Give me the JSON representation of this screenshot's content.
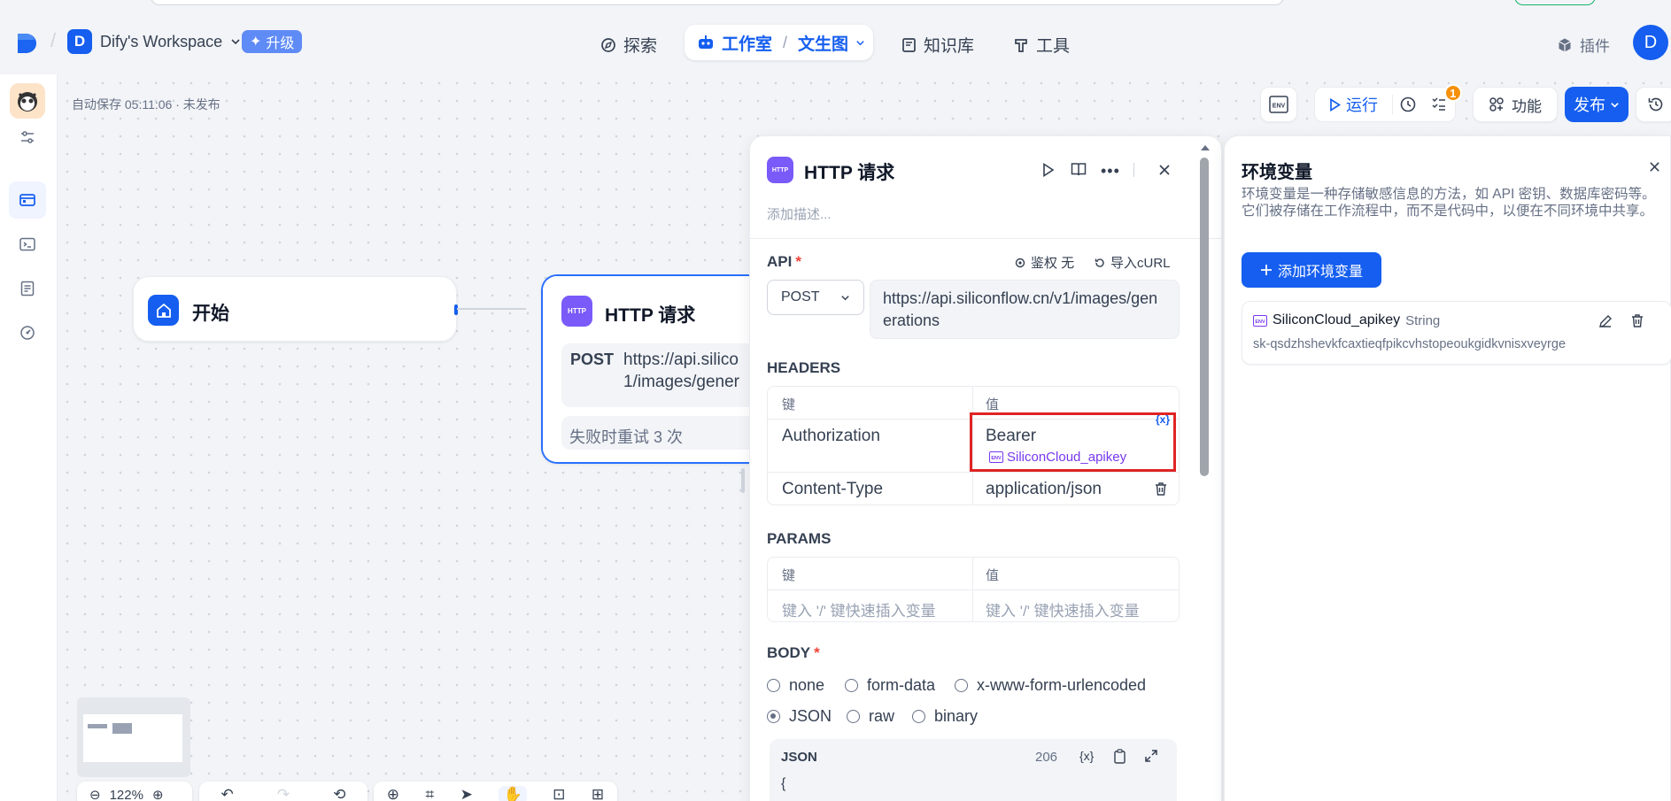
{
  "topnav": {
    "workspace_initial": "D",
    "workspace_name": "Dify's Workspace",
    "upgrade_label": "升级",
    "explore_label": "探索",
    "studio_label": "工作室",
    "app_name": "文生图",
    "knowledge_label": "知识库",
    "tools_label": "工具",
    "plugins_label": "插件",
    "user_initial": "D"
  },
  "canvas": {
    "autosave_text": "自动保存 05:11:06 · 未发布",
    "run_label": "运行",
    "checklist_count": "1",
    "features_label": "功能",
    "publish_label": "发布",
    "start_node_label": "开始",
    "http_node": {
      "badge": "HTTP",
      "title": "HTTP 请求",
      "method": "POST",
      "url_line1": "https://api.silico",
      "url_line2": "1/images/gener",
      "retry_text": "失败时重试 3 次"
    },
    "zoom_label": "122%"
  },
  "http_panel": {
    "badge": "HTTP",
    "title": "HTTP 请求",
    "description_placeholder": "添加描述...",
    "api_label": "API",
    "required_mark": "*",
    "auth_label": "鉴权 无",
    "import_curl_label": "导入cURL",
    "method": "POST",
    "url": "https://api.siliconflow.cn/v1/images/generations",
    "headers_label": "HEADERS",
    "col_key": "键",
    "col_value": "值",
    "headers": [
      {
        "key": "Authorization",
        "value": "Bearer",
        "env_var": "SiliconCloud_apikey"
      },
      {
        "key": "Content-Type",
        "value": "application/json"
      }
    ],
    "var_insert_label": "{x}",
    "params_label": "PARAMS",
    "params_key_placeholder": "键入 '/' 键快速插入变量",
    "params_value_placeholder": "键入 '/' 键快速插入变量",
    "body_label": "BODY",
    "body_options": [
      "none",
      "form-data",
      "x-www-form-urlencoded",
      "JSON",
      "raw",
      "binary"
    ],
    "body_selected": "JSON",
    "json_label": "JSON",
    "json_count": "206",
    "json_first_line": "{"
  },
  "env_panel": {
    "title": "环境变量",
    "description": "环境变量是一种存储敏感信息的方法，如 API 密钥、数据库密码等。它们被存储在工作流程中，而不是代码中，以便在不同环境中共享。",
    "add_label": "添加环境变量",
    "variable": {
      "name": "SiliconCloud_apikey",
      "type": "String",
      "value": "sk-qsdzhshevkfcaxtieqfpikcvhstopeoukgidkvnisxveyrge"
    }
  },
  "colors": {
    "primary": "#155eef",
    "highlight_border": "#e02424",
    "env_purple": "#7839ee",
    "http_badge": "#7a5af8",
    "orange_badge": "#f79009"
  }
}
